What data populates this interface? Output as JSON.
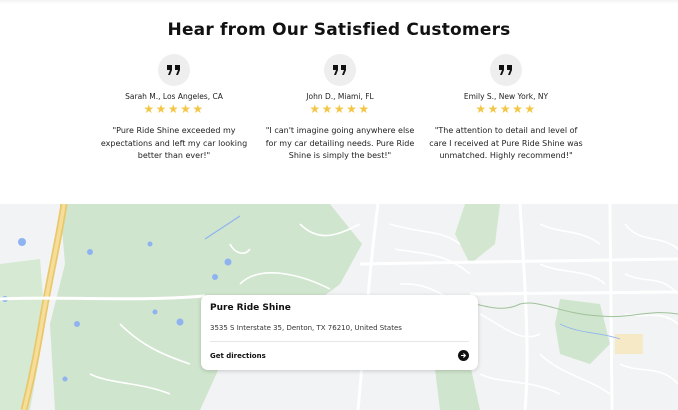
{
  "section": {
    "heading": "Hear from Our Satisfied Customers"
  },
  "testimonials": [
    {
      "author": "Sarah M., Los Angeles, CA",
      "rating": 5,
      "stars": "★★★★★",
      "quote": "\"Pure Ride Shine exceeded my expectations and left my car looking better than ever!\""
    },
    {
      "author": "John D., Miami, FL",
      "rating": 5,
      "stars": "★★★★★",
      "quote": "\"I can't imagine going anywhere else for my car detailing needs. Pure Ride Shine is simply the best!\""
    },
    {
      "author": "Emily S., New York, NY",
      "rating": 5,
      "stars": "★★★★★",
      "quote": "\"The attention to detail and level of care I received at Pure Ride Shine was unmatched. Highly recommend!\""
    }
  ],
  "icons": {
    "quote": "quote-icon",
    "star": "star-icon",
    "arrow": "arrow-right-icon"
  },
  "colors": {
    "star": "#f3c745",
    "map_background": "#f2f3f4",
    "park_green": "#cfe5cd",
    "highway_yellow": "#f1d27a",
    "water_blue": "#8fb3f0"
  },
  "map_card": {
    "title": "Pure Ride Shine",
    "address": "3535 S Interstate 35, Denton, TX 76210, United States",
    "directions_label": "Get directions"
  }
}
